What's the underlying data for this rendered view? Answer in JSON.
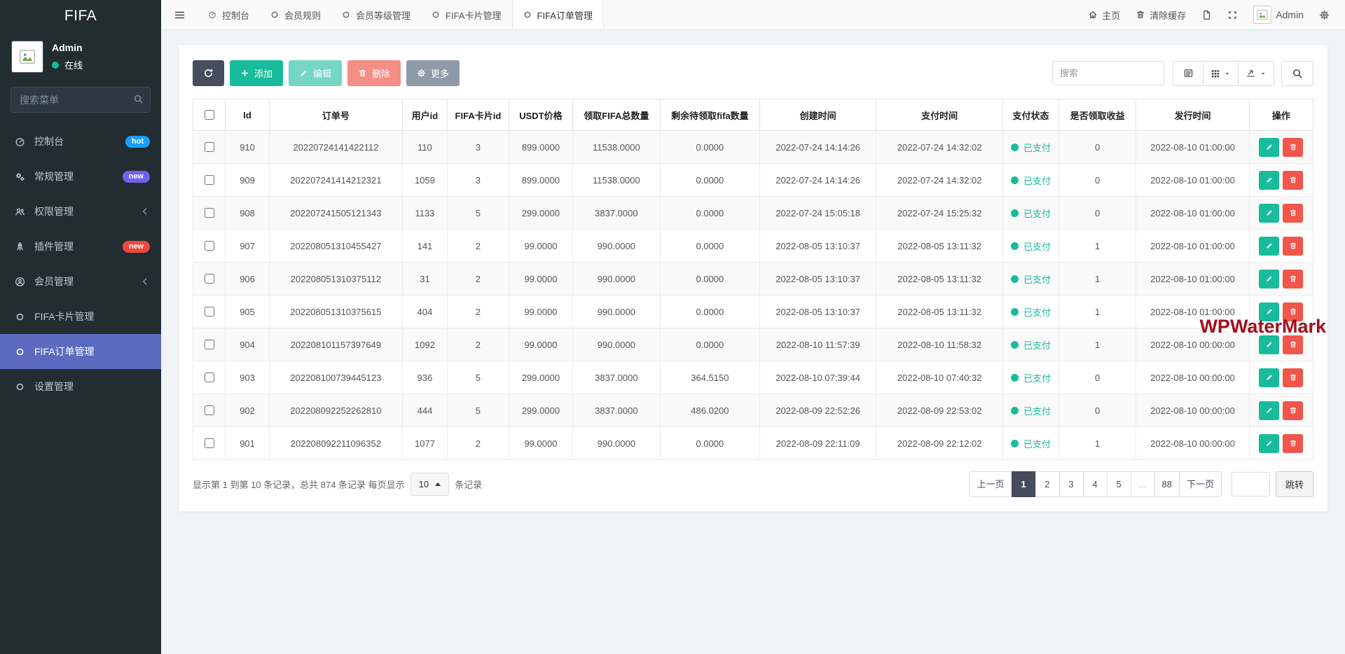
{
  "sidebar": {
    "logo": "FIFA",
    "user": {
      "name": "Admin",
      "status_label": "在线"
    },
    "search_placeholder": "搜索菜单",
    "menu": [
      {
        "key": "dashboard",
        "label": "控制台",
        "icon": "gauge-icon",
        "badge": {
          "text": "hot",
          "color": "#189ff6"
        }
      },
      {
        "key": "general",
        "label": "常规管理",
        "icon": "gears-icon",
        "badge": {
          "text": "new",
          "color": "#7460ee"
        }
      },
      {
        "key": "auth",
        "label": "权限管理",
        "icon": "users-icon",
        "chevron": true
      },
      {
        "key": "addon",
        "label": "插件管理",
        "icon": "rocket-icon",
        "badge": {
          "text": "new",
          "color": "#ef473a"
        }
      },
      {
        "key": "member",
        "label": "会员管理",
        "icon": "member-icon",
        "chevron": true
      },
      {
        "key": "fifa-card",
        "label": "FIFA卡片管理",
        "icon": "circle-icon"
      },
      {
        "key": "fifa-order",
        "label": "FIFA订单管理",
        "icon": "circle-icon",
        "active": true
      },
      {
        "key": "settings",
        "label": "设置管理",
        "icon": "circle-icon"
      }
    ]
  },
  "topbar": {
    "tabs": [
      {
        "key": "dashboard",
        "label": "控制台",
        "icon": "gauge-icon"
      },
      {
        "key": "member-rule",
        "label": "会员规则",
        "icon": "circle-icon"
      },
      {
        "key": "member-level",
        "label": "会员等级管理",
        "icon": "circle-icon"
      },
      {
        "key": "fifa-card",
        "label": "FIFA卡片管理",
        "icon": "circle-icon"
      },
      {
        "key": "fifa-order",
        "label": "FIFA订单管理",
        "icon": "circle-icon",
        "active": true
      }
    ],
    "home_label": "主页",
    "clear_cache_label": "清除缓存",
    "username": "Admin"
  },
  "toolbar": {
    "add_label": "添加",
    "edit_label": "编辑",
    "delete_label": "删除",
    "more_label": "更多",
    "search_placeholder": "搜索"
  },
  "table": {
    "columns": [
      "Id",
      "订单号",
      "用户id",
      "FIFA卡片id",
      "USDT价格",
      "领取FIFA总数量",
      "剩余待领取fifa数量",
      "创建时间",
      "支付时间",
      "支付状态",
      "是否领取收益",
      "发行时间",
      "操作"
    ],
    "paid_label": "已支付",
    "rows": [
      {
        "id": "910",
        "order_no": "20220724141422112",
        "user_id": "110",
        "card_id": "3",
        "usdt_price": "899.0000",
        "total": "11538.0000",
        "remaining": "0.0000",
        "created": "2022-07-24 14:14:26",
        "paid": "2022-07-24 14:32:02",
        "received": "0",
        "issued": "2022-08-10 01:00:00"
      },
      {
        "id": "909",
        "order_no": "202207241414212321",
        "user_id": "1059",
        "card_id": "3",
        "usdt_price": "899.0000",
        "total": "11538.0000",
        "remaining": "0.0000",
        "created": "2022-07-24 14:14:26",
        "paid": "2022-07-24 14:32:02",
        "received": "0",
        "issued": "2022-08-10 01:00:00"
      },
      {
        "id": "908",
        "order_no": "202207241505121343",
        "user_id": "1133",
        "card_id": "5",
        "usdt_price": "299.0000",
        "total": "3837.0000",
        "remaining": "0.0000",
        "created": "2022-07-24 15:05:18",
        "paid": "2022-07-24 15:25:32",
        "received": "0",
        "issued": "2022-08-10 01:00:00"
      },
      {
        "id": "907",
        "order_no": "202208051310455427",
        "user_id": "141",
        "card_id": "2",
        "usdt_price": "99.0000",
        "total": "990.0000",
        "remaining": "0.0000",
        "created": "2022-08-05 13:10:37",
        "paid": "2022-08-05 13:11:32",
        "received": "1",
        "issued": "2022-08-10 01:00:00"
      },
      {
        "id": "906",
        "order_no": "202208051310375112",
        "user_id": "31",
        "card_id": "2",
        "usdt_price": "99.0000",
        "total": "990.0000",
        "remaining": "0.0000",
        "created": "2022-08-05 13:10:37",
        "paid": "2022-08-05 13:11:32",
        "received": "1",
        "issued": "2022-08-10 01:00:00"
      },
      {
        "id": "905",
        "order_no": "202208051310375615",
        "user_id": "404",
        "card_id": "2",
        "usdt_price": "99.0000",
        "total": "990.0000",
        "remaining": "0.0000",
        "created": "2022-08-05 13:10:37",
        "paid": "2022-08-05 13:11:32",
        "received": "1",
        "issued": "2022-08-10 01:00:00"
      },
      {
        "id": "904",
        "order_no": "202208101157397649",
        "user_id": "1092",
        "card_id": "2",
        "usdt_price": "99.0000",
        "total": "990.0000",
        "remaining": "0.0000",
        "created": "2022-08-10 11:57:39",
        "paid": "2022-08-10 11:58:32",
        "received": "1",
        "issued": "2022-08-10 00:00:00"
      },
      {
        "id": "903",
        "order_no": "202208100739445123",
        "user_id": "936",
        "card_id": "5",
        "usdt_price": "299.0000",
        "total": "3837.0000",
        "remaining": "364.5150",
        "created": "2022-08-10 07:39:44",
        "paid": "2022-08-10 07:40:32",
        "received": "0",
        "issued": "2022-08-10 00:00:00"
      },
      {
        "id": "902",
        "order_no": "202208092252262810",
        "user_id": "444",
        "card_id": "5",
        "usdt_price": "299.0000",
        "total": "3837.0000",
        "remaining": "486.0200",
        "created": "2022-08-09 22:52:26",
        "paid": "2022-08-09 22:53:02",
        "received": "0",
        "issued": "2022-08-10 00:00:00"
      },
      {
        "id": "901",
        "order_no": "202208092211096352",
        "user_id": "1077",
        "card_id": "2",
        "usdt_price": "99.0000",
        "total": "990.0000",
        "remaining": "0.0000",
        "created": "2022-08-09 22:11:09",
        "paid": "2022-08-09 22:12:02",
        "received": "1",
        "issued": "2022-08-10 00:00:00"
      }
    ]
  },
  "footer": {
    "summary_prefix": "显示第 1 到第 10 条记录，总共 874 条记录 每页显示",
    "page_size": "10",
    "summary_suffix": "条记录",
    "pagination": [
      "上一页",
      "1",
      "2",
      "3",
      "4",
      "5",
      "...",
      "88",
      "下一页"
    ],
    "active_page": "1",
    "jump_label": "跳转"
  },
  "watermark": {
    "text": "WPWaterMark",
    "color": "#a30d1d"
  },
  "colors": {
    "sidebar_bg": "#222d32",
    "sidebar_active": "#5c6bc0",
    "success": "#18bc9c",
    "danger": "#f0564a",
    "dark": "#444c5c"
  }
}
